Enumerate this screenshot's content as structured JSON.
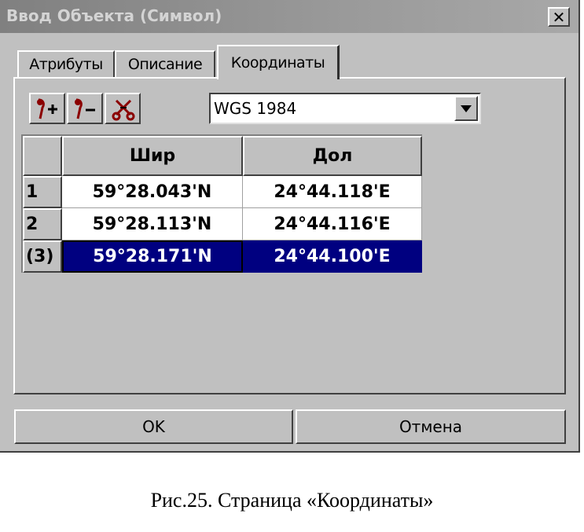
{
  "window": {
    "title": "Ввод Объекта (Символ)",
    "close_glyph": "✕"
  },
  "tabs": [
    {
      "label": "Атрибуты",
      "active": false
    },
    {
      "label": "Описание",
      "active": false
    },
    {
      "label": "Координаты",
      "active": true
    }
  ],
  "toolbar": {
    "buttons": [
      {
        "icon": "add-point-icon",
        "sign": "+"
      },
      {
        "icon": "remove-point-icon",
        "sign": "−"
      },
      {
        "icon": "cut-points-icon",
        "sign": ""
      }
    ],
    "icon_color": "#8b0000"
  },
  "datum": {
    "selected": "WGS 1984"
  },
  "grid": {
    "columns": [
      "Шир",
      "Дол"
    ],
    "rows": [
      {
        "index": "1",
        "lat": "59°28.043'N",
        "lon": "24°44.118'E",
        "selected": false
      },
      {
        "index": "2",
        "lat": "59°28.113'N",
        "lon": "24°44.116'E",
        "selected": false
      },
      {
        "index": "(3)",
        "lat": "59°28.171'N",
        "lon": "24°44.100'E",
        "selected": true
      }
    ],
    "selection_color": "#000080"
  },
  "buttons": {
    "ok": "OK",
    "cancel": "Отмена"
  },
  "caption": "Рис.25. Страница «Координаты»"
}
